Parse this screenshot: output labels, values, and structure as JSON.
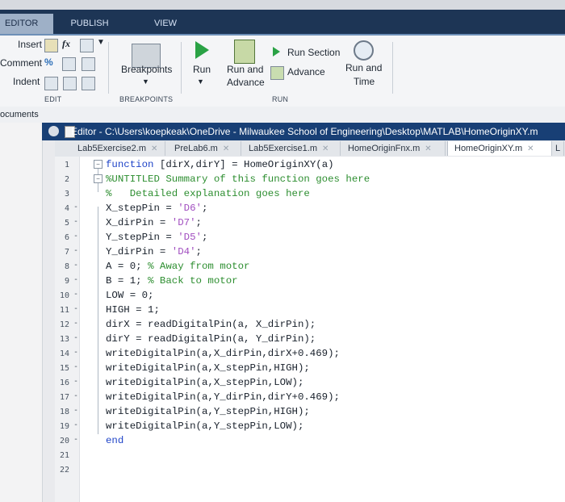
{
  "toolstrip": {
    "tabs": [
      "EDITOR",
      "PUBLISH",
      "VIEW"
    ],
    "edit": {
      "insert": "Insert",
      "comment": "Comment",
      "indent": "Indent",
      "fx": "fx",
      "group": "EDIT"
    },
    "breakpoints": {
      "label": "Breakpoints",
      "group": "BREAKPOINTS"
    },
    "run": {
      "run": "Run",
      "run_and_advance_1": "Run and",
      "run_and_advance_2": "Advance",
      "run_section": "Run Section",
      "advance": "Advance",
      "run_and_time_1": "Run and",
      "run_and_time_2": "Time",
      "group": "RUN"
    },
    "colors": {
      "tab_bar": "#1d3555",
      "editor_titlebar": "#183f75",
      "run_green": "#2aa245"
    }
  },
  "left_panel": {
    "title": "ocuments"
  },
  "editor": {
    "title": "Editor - C:\\Users\\koepkeak\\OneDrive - Milwaukee School of Engineering\\Desktop\\MATLAB\\HomeOriginXY.m",
    "tabs": [
      {
        "label": "Lab5Exercise2.m"
      },
      {
        "label": "PreLab6.m"
      },
      {
        "label": "Lab5Exercise1.m"
      },
      {
        "label": "HomeOriginFnx.m"
      },
      {
        "label": "HomeOriginXY.m"
      },
      {
        "label": "L"
      }
    ],
    "tab_close": "✕",
    "lines": [
      {
        "n": "1",
        "dash": "",
        "text": "function [dirX,dirY] = HomeOriginXY(a)"
      },
      {
        "n": "2",
        "dash": "",
        "text": "%UNTITLED Summary of this function goes here"
      },
      {
        "n": "3",
        "dash": "",
        "text": "%   Detailed explanation goes here"
      },
      {
        "n": "4",
        "dash": "-",
        "text": "X_stepPin = 'D6';"
      },
      {
        "n": "5",
        "dash": "-",
        "text": "X_dirPin = 'D7';"
      },
      {
        "n": "6",
        "dash": "-",
        "text": "Y_stepPin = 'D5';"
      },
      {
        "n": "7",
        "dash": "-",
        "text": "Y_dirPin = 'D4';"
      },
      {
        "n": "8",
        "dash": "-",
        "text": "A = 0; % Away from motor"
      },
      {
        "n": "9",
        "dash": "-",
        "text": "B = 1; % Back to motor"
      },
      {
        "n": "10",
        "dash": "-",
        "text": "LOW = 0;"
      },
      {
        "n": "11",
        "dash": "-",
        "text": "HIGH = 1;"
      },
      {
        "n": "12",
        "dash": "-",
        "text": "dirX = readDigitalPin(a, X_dirPin);"
      },
      {
        "n": "13",
        "dash": "-",
        "text": "dirY = readDigitalPin(a, Y_dirPin);"
      },
      {
        "n": "14",
        "dash": "-",
        "text": "writeDigitalPin(a,X_dirPin,dirX+0.469);"
      },
      {
        "n": "15",
        "dash": "-",
        "text": "writeDigitalPin(a,X_stepPin,HIGH);"
      },
      {
        "n": "16",
        "dash": "-",
        "text": "writeDigitalPin(a,X_stepPin,LOW);"
      },
      {
        "n": "17",
        "dash": "-",
        "text": "writeDigitalPin(a,Y_dirPin,dirY+0.469);"
      },
      {
        "n": "18",
        "dash": "-",
        "text": "writeDigitalPin(a,Y_stepPin,HIGH);"
      },
      {
        "n": "19",
        "dash": "-",
        "text": "writeDigitalPin(a,Y_stepPin,LOW);"
      },
      {
        "n": "20",
        "dash": "-",
        "text": "end"
      },
      {
        "n": "21",
        "dash": "",
        "text": ""
      },
      {
        "n": "22",
        "dash": "",
        "text": ""
      }
    ]
  }
}
